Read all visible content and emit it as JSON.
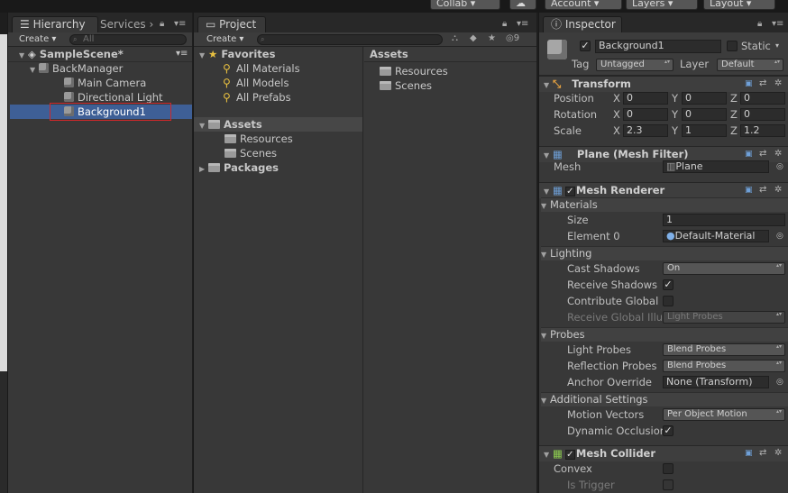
{
  "toolbar": {
    "collab": "Collab",
    "account": "Account",
    "layers": "Layers",
    "layout": "Layout",
    "cloud_icon": "cloud-icon"
  },
  "hierarchy": {
    "tab": "Hierarchy",
    "tab2": "Services",
    "create": "Create",
    "search_placeholder": "All",
    "scene": "SampleScene*",
    "items": [
      "BackManager",
      "Main Camera",
      "Directional Light",
      "Background1"
    ]
  },
  "project": {
    "tab": "Project",
    "create": "Create",
    "badge": "9",
    "favorites": "Favorites",
    "fav_items": [
      "All Materials",
      "All Models",
      "All Prefabs"
    ],
    "assets": "Assets",
    "asset_items": [
      "Resources",
      "Scenes"
    ],
    "packages": "Packages",
    "right_header": "Assets",
    "right_items": [
      "Resources",
      "Scenes"
    ]
  },
  "inspector": {
    "tab": "Inspector",
    "name": "Background1",
    "static_label": "Static",
    "tag_label": "Tag",
    "tag_value": "Untagged",
    "layer_label": "Layer",
    "layer_value": "Default",
    "transform": {
      "title": "Transform",
      "position_label": "Position",
      "rotation_label": "Rotation",
      "scale_label": "Scale",
      "x": "X",
      "y": "Y",
      "z": "Z",
      "position": [
        "0",
        "0",
        "0"
      ],
      "rotation": [
        "0",
        "0",
        "0"
      ],
      "scale": [
        "2.3",
        "1",
        "1.2"
      ]
    },
    "mesh_filter": {
      "title": "Plane (Mesh Filter)",
      "mesh_label": "Mesh",
      "mesh_value": "Plane"
    },
    "mesh_renderer": {
      "title": "Mesh Renderer",
      "materials": "Materials",
      "size_label": "Size",
      "size_value": "1",
      "element0_label": "Element 0",
      "element0_value": "Default-Material",
      "lighting": "Lighting",
      "cast_shadows_label": "Cast Shadows",
      "cast_shadows_value": "On",
      "receive_shadows_label": "Receive Shadows",
      "contribute_gi_label": "Contribute Global",
      "receive_gi_label": "Receive Global Illu",
      "receive_gi_value": "Light Probes",
      "probes": "Probes",
      "light_probes_label": "Light Probes",
      "light_probes_value": "Blend Probes",
      "reflection_probes_label": "Reflection Probes",
      "reflection_probes_value": "Blend Probes",
      "anchor_override_label": "Anchor Override",
      "anchor_override_value": "None (Transform)",
      "additional": "Additional Settings",
      "motion_vectors_label": "Motion Vectors",
      "motion_vectors_value": "Per Object Motion",
      "dynamic_occlusion_label": "Dynamic Occlusion"
    },
    "mesh_collider": {
      "title": "Mesh Collider",
      "convex_label": "Convex",
      "is_trigger_label": "Is Trigger"
    }
  },
  "colors": {
    "selection": "#3e5f96",
    "highlight_box": "#d0282a",
    "panel": "#383838"
  }
}
